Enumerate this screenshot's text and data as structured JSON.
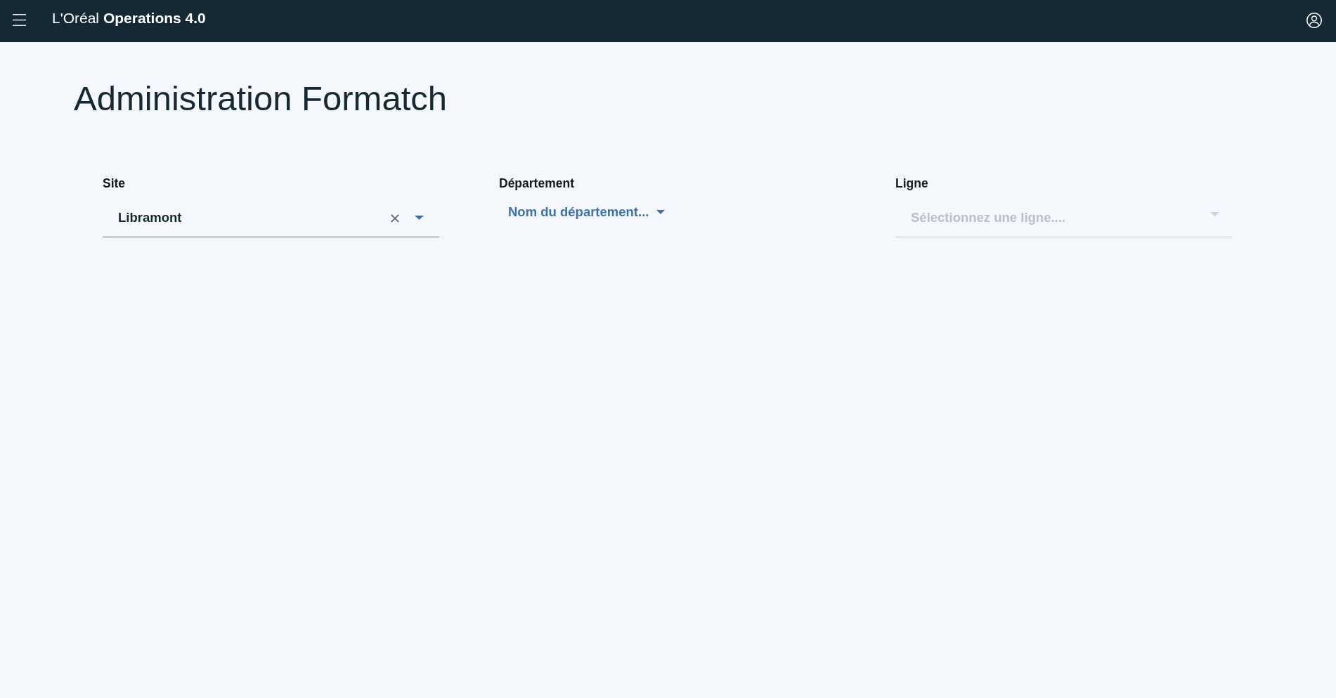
{
  "header": {
    "brand": "L'Oréal **Operations 4.0**"
  },
  "page": {
    "title": "Administration Formatch"
  },
  "filters": [
    {
      "kind": "combobox",
      "label": "Site",
      "value": "Libramont",
      "clearable": true,
      "disabled": false
    },
    {
      "kind": "inline",
      "label": "Département",
      "placeholder": "Nom du département...",
      "disabled": false
    },
    {
      "kind": "combobox",
      "label": "Ligne",
      "placeholder": "Sélectionnez une ligne....",
      "clearable": false,
      "disabled": true
    }
  ]
}
